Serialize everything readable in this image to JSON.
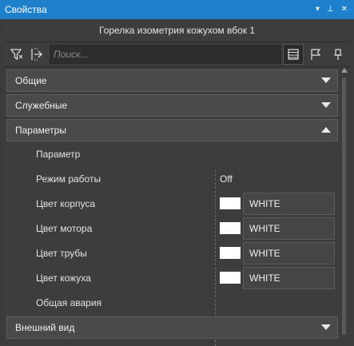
{
  "window": {
    "title": "Свойства",
    "pin_glyph": "▾",
    "autohide_glyph": "⊥",
    "close_glyph": "✕"
  },
  "object_title": "Горелка изометрия кожухом вбок 1",
  "toolbar": {
    "search_placeholder": "Поиск...",
    "icons": [
      "filter-icon",
      "collapse-icon",
      "list-view-icon",
      "flag-icon",
      "pin-icon"
    ]
  },
  "sections": {
    "general": "Общие",
    "service": "Служебные",
    "parameters": "Параметры",
    "appearance": "Внешний вид"
  },
  "parameters": {
    "header": "Параметр",
    "mode": {
      "label": "Режим работы",
      "value": "Off"
    },
    "body_color": {
      "label": "Цвет корпуса",
      "value": "WHITE",
      "swatch": "#ffffff"
    },
    "motor_color": {
      "label": "Цвет мотора",
      "value": "WHITE",
      "swatch": "#ffffff"
    },
    "pipe_color": {
      "label": "Цвет трубы",
      "value": "WHITE",
      "swatch": "#ffffff"
    },
    "casing_color": {
      "label": "Цвет кожуха",
      "value": "WHITE",
      "swatch": "#ffffff"
    },
    "alarm": {
      "label": "Общая авария"
    }
  },
  "colors": {
    "titlebar": "#1e80cc",
    "panel": "#3d3d3d",
    "section": "#4a4a4a"
  }
}
